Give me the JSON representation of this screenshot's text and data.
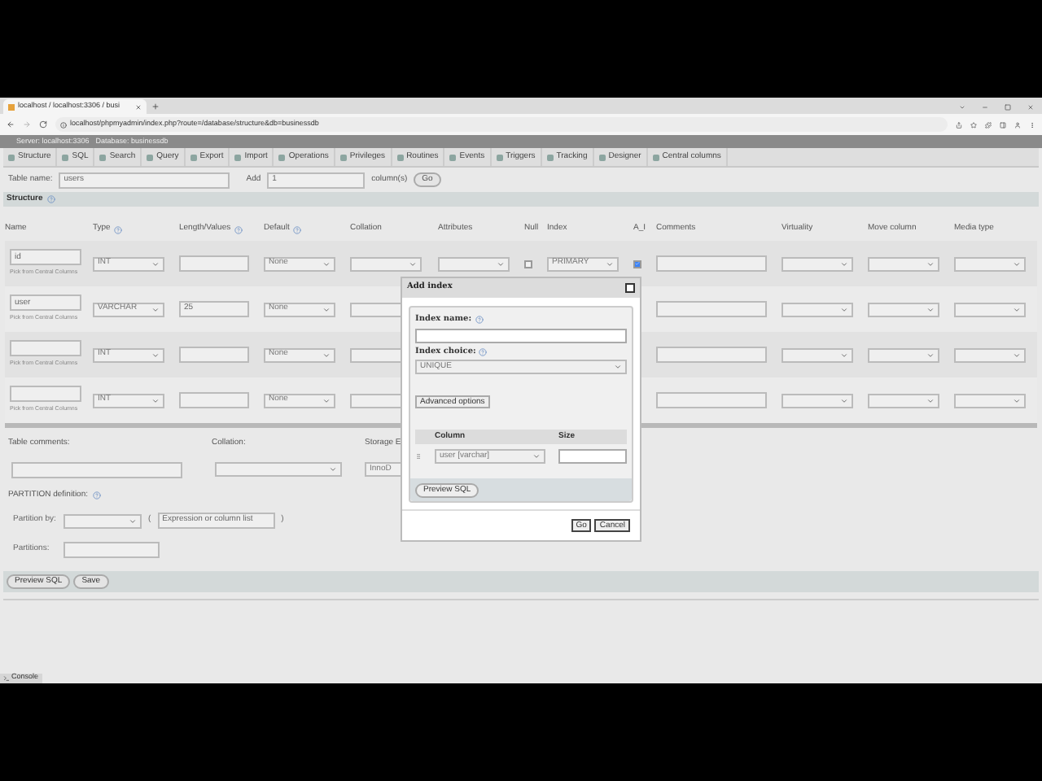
{
  "browser": {
    "tab_title": "localhost / localhost:3306 / busi",
    "url": "localhost/phpmyadmin/index.php?route=/database/structure&db=businessdb"
  },
  "breadcrumb": [
    "Server: localhost:3306",
    "Database: businessdb"
  ],
  "menu": [
    {
      "label": "Structure",
      "selected": false
    },
    {
      "label": "SQL",
      "selected": false
    },
    {
      "label": "Search",
      "selected": false
    },
    {
      "label": "Query",
      "selected": false
    },
    {
      "label": "Export",
      "selected": false
    },
    {
      "label": "Import",
      "selected": false
    },
    {
      "label": "Operations",
      "selected": false
    },
    {
      "label": "Privileges",
      "selected": false
    },
    {
      "label": "Routines",
      "selected": false
    },
    {
      "label": "Events",
      "selected": false
    },
    {
      "label": "Triggers",
      "selected": false
    },
    {
      "label": "Tracking",
      "selected": false
    },
    {
      "label": "Designer",
      "selected": false
    },
    {
      "label": "Central columns",
      "selected": false
    }
  ],
  "table_name": {
    "label": "Table name:",
    "value": "users"
  },
  "add": {
    "label": "Add",
    "value": "1",
    "unit": "column(s)",
    "button": "Go"
  },
  "section_title": "Structure",
  "columns": [
    "Name",
    "Type",
    "Length/Values",
    "Default",
    "Collation",
    "Attributes",
    "Null",
    "Index",
    "A_I",
    "Comments",
    "Virtuality",
    "Move column",
    "Media type"
  ],
  "rows": [
    {
      "name": "id",
      "pick": "Pick from Central Columns",
      "type": "INT",
      "length": "",
      "default": "None",
      "null": false,
      "index": "PRIMARY",
      "ai": true
    },
    {
      "name": "user",
      "pick": "Pick from Central Columns",
      "type": "VARCHAR",
      "length": "25",
      "default": "None"
    },
    {
      "name": "",
      "pick": "Pick from Central Columns",
      "type": "INT",
      "length": "",
      "default": "None"
    },
    {
      "name": "",
      "pick": "Pick from Central Columns",
      "type": "INT",
      "length": "",
      "default": "None"
    }
  ],
  "table_comments": "Table comments:",
  "collation": "Collation:",
  "storage": "Storage E",
  "engine": "InnoD",
  "partition": {
    "title": "PARTITION definition:",
    "by_label": "Partition by:",
    "open": "(",
    "placeholder": "Expression or column list",
    "close": ")",
    "count_label": "Partitions:"
  },
  "actions": [
    "Preview SQL",
    "Save"
  ],
  "console": "Console",
  "dialog": {
    "title": "Add index",
    "name_label": "Index name:",
    "choice_label": "Index choice:",
    "choice": "UNIQUE",
    "advanced": "Advanced options",
    "col_header": "Column",
    "size_header": "Size",
    "column": "user [varchar]",
    "preview": "Preview SQL",
    "ok": "Go",
    "cancel": "Cancel"
  }
}
